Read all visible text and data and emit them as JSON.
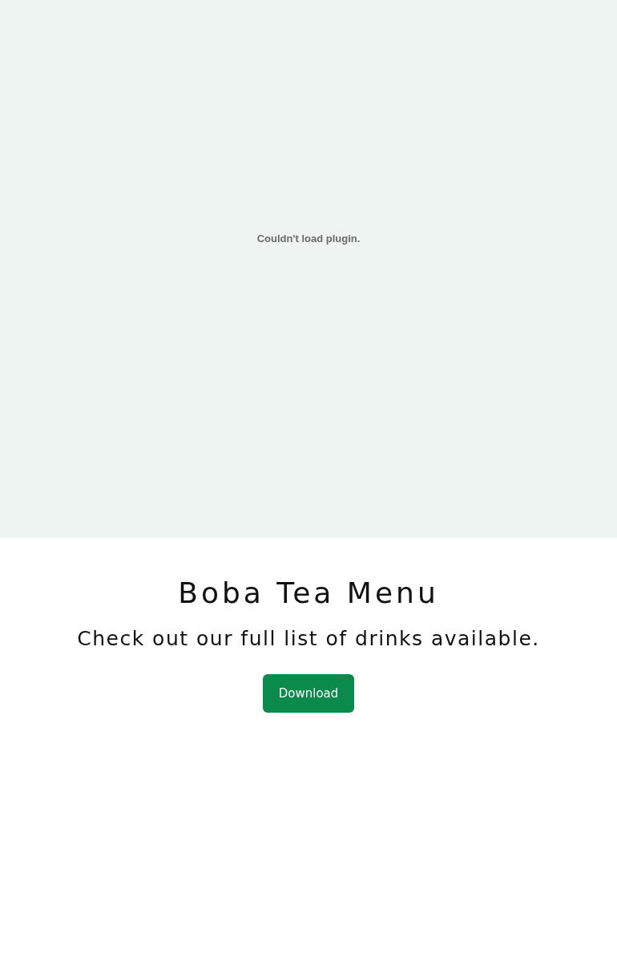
{
  "plugin": {
    "message": "Couldn't load plugin."
  },
  "menu": {
    "title": "Boba Tea Menu",
    "subtitle": "Check out our full list of drinks available.",
    "button": "Download"
  }
}
